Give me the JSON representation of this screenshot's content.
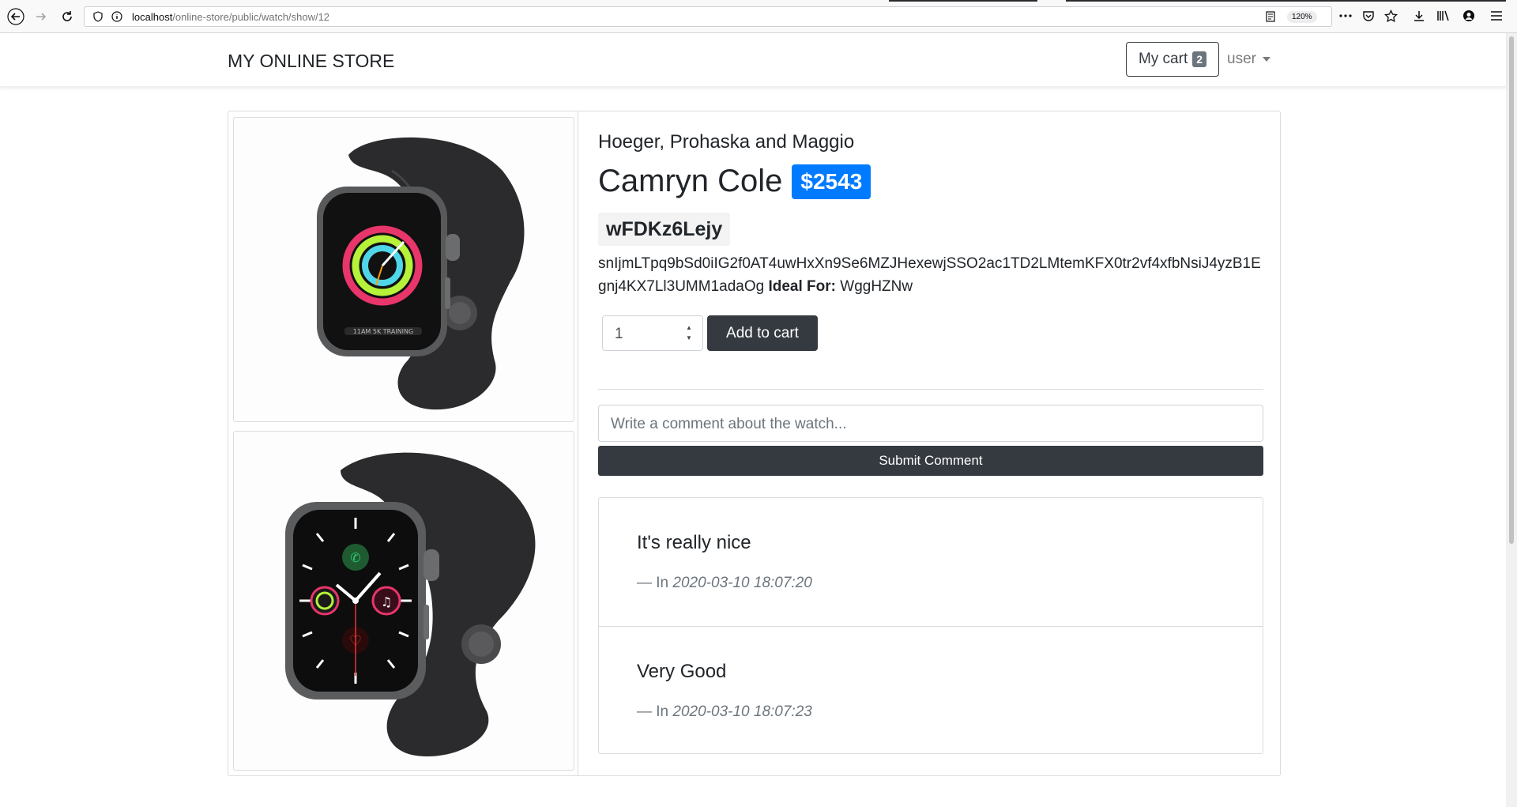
{
  "browser": {
    "url_host": "localhost",
    "url_path": "/online-store/public/watch/show/12",
    "zoom": "120%"
  },
  "navbar": {
    "brand": "MY ONLINE STORE",
    "cart_label": "My cart",
    "cart_count": "2",
    "user_label": "user"
  },
  "product": {
    "maker": "Hoeger, Prohaska and Maggio",
    "name": "Camryn Cole",
    "price": "$2543",
    "sku": "wFDKz6Lejy",
    "description": "snIjmLTpq9bSd0iIG2f0AT4uwHxXn9Se6MZJHexewjSSO2ac1TD2LMtemKFX0tr2vf4xfbNsiJ4yzB1Egnj4KX7Ll3UMM1adaOg",
    "ideal_for_label": "Ideal For:",
    "ideal_for_value": "WggHZNw",
    "quantity": "1",
    "add_to_cart_label": "Add to cart"
  },
  "comment_form": {
    "placeholder": "Write a comment about the watch...",
    "submit_label": "Submit Comment"
  },
  "comments": [
    {
      "text": "It's really nice",
      "prefix": "— In",
      "date": "2020-03-10 18:07:20"
    },
    {
      "text": "Very Good",
      "prefix": "— In",
      "date": "2020-03-10 18:07:23"
    }
  ],
  "colors": {
    "primary": "#007bff",
    "dark": "#343a40",
    "badge_gray": "#6c757d"
  }
}
